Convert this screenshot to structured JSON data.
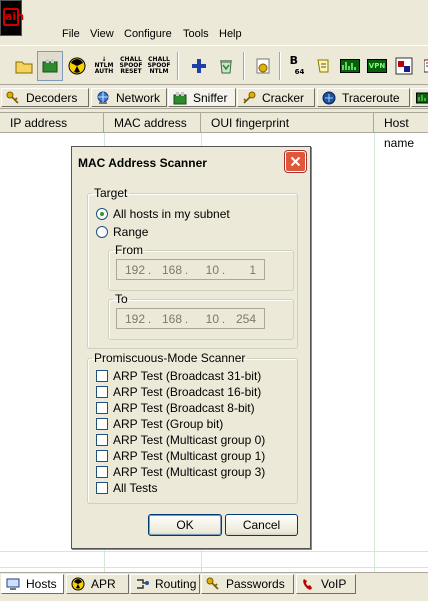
{
  "menubar": {
    "items": [
      "File",
      "View",
      "Configure",
      "Tools",
      "Help"
    ]
  },
  "toolbar": {
    "buttons": [
      {
        "icon": "open-folder-icon"
      },
      {
        "icon": "sniffer-adapter-icon"
      },
      {
        "icon": "radiation-icon"
      },
      {
        "icon": "ntlm-auth-icon",
        "text": [
          "NTLM",
          "AUTH"
        ]
      },
      {
        "icon": "chall-spoof-reset-icon",
        "text": [
          "CHALL",
          "SPOOF",
          "RESET"
        ]
      },
      {
        "icon": "chall-spoof-ntlm-icon",
        "text": [
          "CHALL",
          "SPOOF",
          "NTLM"
        ]
      },
      {
        "icon": "plus-icon"
      },
      {
        "icon": "recycle-icon"
      },
      {
        "icon": "cert-icon"
      },
      {
        "icon": "base64-icon",
        "text": [
          "B",
          "64"
        ]
      },
      {
        "icon": "scroll-icon"
      },
      {
        "icon": "meter-icon"
      },
      {
        "icon": "vpn-icon",
        "text": [
          "VPN"
        ]
      },
      {
        "icon": "rdp-icon"
      },
      {
        "icon": "cut-icon"
      }
    ]
  },
  "tabs": [
    {
      "label": "Decoders",
      "icon": "decoder-key-icon"
    },
    {
      "label": "Network",
      "icon": "network-globe-icon"
    },
    {
      "label": "Sniffer",
      "icon": "sniffer-icon",
      "active": true
    },
    {
      "label": "Cracker",
      "icon": "cracker-key-icon"
    },
    {
      "label": "Traceroute",
      "icon": "traceroute-icon"
    }
  ],
  "listview": {
    "columns": [
      "IP address",
      "MAC address",
      "OUI fingerprint",
      "Host name"
    ]
  },
  "bottom_tabs": [
    {
      "label": "Hosts",
      "icon": "hosts-icon",
      "active": true
    },
    {
      "label": "APR",
      "icon": "apr-radiation-icon"
    },
    {
      "label": "Routing",
      "icon": "routing-icon"
    },
    {
      "label": "Passwords",
      "icon": "passwords-key-icon"
    },
    {
      "label": "VoIP",
      "icon": "voip-icon"
    }
  ],
  "dialog": {
    "title": "MAC Address Scanner",
    "target": {
      "legend": "Target",
      "options": [
        {
          "label": "All hosts in my subnet",
          "selected": true
        },
        {
          "label": "Range",
          "selected": false
        }
      ],
      "from": {
        "legend": "From",
        "octets": [
          "192",
          "168",
          "10",
          "1"
        ]
      },
      "to": {
        "legend": "To",
        "octets": [
          "192",
          "168",
          "10",
          "254"
        ]
      }
    },
    "promiscuous": {
      "legend": "Promiscuous-Mode Scanner",
      "checks": [
        {
          "label": "ARP Test (Broadcast 31-bit)",
          "checked": false
        },
        {
          "label": "ARP Test (Broadcast 16-bit)",
          "checked": false
        },
        {
          "label": "ARP Test (Broadcast 8-bit)",
          "checked": false
        },
        {
          "label": "ARP Test (Group bit)",
          "checked": false
        },
        {
          "label": "ARP Test (Multicast group 0)",
          "checked": false
        },
        {
          "label": "ARP Test (Multicast group 1)",
          "checked": false
        },
        {
          "label": "ARP Test (Multicast group 3)",
          "checked": false
        },
        {
          "label": "All Tests",
          "checked": false
        }
      ]
    },
    "ok_label": "OK",
    "cancel_label": "Cancel"
  },
  "colors": {
    "window_bg": "#ece9d8",
    "close_button": "#e0583a",
    "grid": "#d4e8d4",
    "app_icon_red": "#d00000"
  }
}
